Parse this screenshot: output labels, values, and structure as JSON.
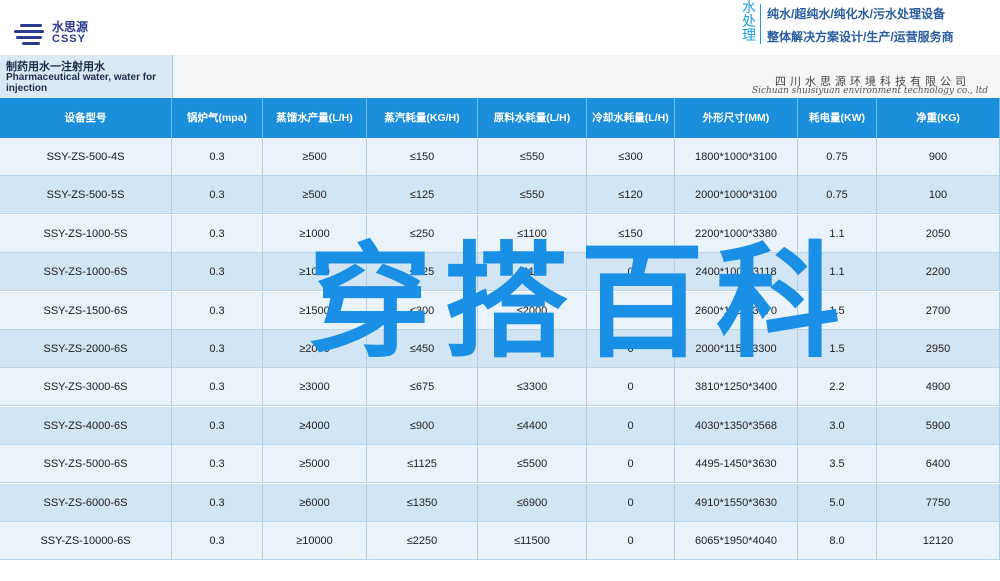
{
  "brand": {
    "logo_cn": "水思源",
    "logo_en": "CSSY",
    "vertical_text": [
      "水",
      "处",
      "理"
    ],
    "slogan1": "纯水/超纯水/纯化水/污水处理设备",
    "slogan2": "整体解决方案设计/生产/运营服务商"
  },
  "title": {
    "cn": "制药用水一注射用水",
    "en": "Pharmaceutical water, water for injection"
  },
  "company": {
    "cn": "四川水思源环境科技有限公司",
    "en": "Sichuan shuisiyuan environment technology co., ltd"
  },
  "headers": [
    "设备型号",
    "锅炉气(mpa)",
    "蒸馏水产量(L/H)",
    "蒸汽耗量(KG/H)",
    "原料水耗量(L/H)",
    "冷却水耗量(L/H)",
    "外形尺寸(MM)",
    "耗电量(KW)",
    "净重(KG)"
  ],
  "rows": [
    [
      "SSY-ZS-500-4S",
      "0.3",
      "≥500",
      "≤150",
      "≤550",
      "≤300",
      "1800*1000*3100",
      "0.75",
      "900"
    ],
    [
      "SSY-ZS-500-5S",
      "0.3",
      "≥500",
      "≤125",
      "≤550",
      "≤120",
      "2000*1000*3100",
      "0.75",
      "100"
    ],
    [
      "SSY-ZS-1000-5S",
      "0.3",
      "≥1000",
      "≤250",
      "≤1100",
      "≤150",
      "2200*1000*3380",
      "1.1",
      "2050"
    ],
    [
      "SSY-ZS-1000-6S",
      "0.3",
      "≥1000",
      "≤225",
      "≤1100",
      "0",
      "2400*1000*3118",
      "1.1",
      "2200"
    ],
    [
      "SSY-ZS-1500-6S",
      "0.3",
      "≥1500",
      "≤300",
      "≤2000",
      "≤200",
      "2600*1000*3170",
      "1.5",
      "2700"
    ],
    [
      "SSY-ZS-2000-6S",
      "0.3",
      "≥2000",
      "≤450",
      "≤2200",
      "0",
      "2000*1150*3300",
      "1.5",
      "2950"
    ],
    [
      "SSY-ZS-3000-6S",
      "0.3",
      "≥3000",
      "≤675",
      "≤3300",
      "0",
      "3810*1250*3400",
      "2.2",
      "4900"
    ],
    [
      "SSY-ZS-4000-6S",
      "0.3",
      "≥4000",
      "≤900",
      "≤4400",
      "0",
      "4030*1350*3568",
      "3.0",
      "5900"
    ],
    [
      "SSY-ZS-5000-6S",
      "0.3",
      "≥5000",
      "≤1125",
      "≤5500",
      "0",
      "4495-1450*3630",
      "3.5",
      "6400"
    ],
    [
      "SSY-ZS-6000-6S",
      "0.3",
      "≥6000",
      "≤1350",
      "≤6900",
      "0",
      "4910*1550*3630",
      "5.0",
      "7750"
    ],
    [
      "SSY-ZS-10000-6S",
      "0.3",
      "≥10000",
      "≤2250",
      "≤11500",
      "0",
      "6065*1950*4040",
      "8.0",
      "12120"
    ]
  ],
  "watermark": "穿搭百科",
  "colors": {
    "header_blue": "#1b8fdc",
    "row_light": "#eaf2fa",
    "row_dark": "#d2e5f4",
    "watermark": "#1a8fe6"
  }
}
